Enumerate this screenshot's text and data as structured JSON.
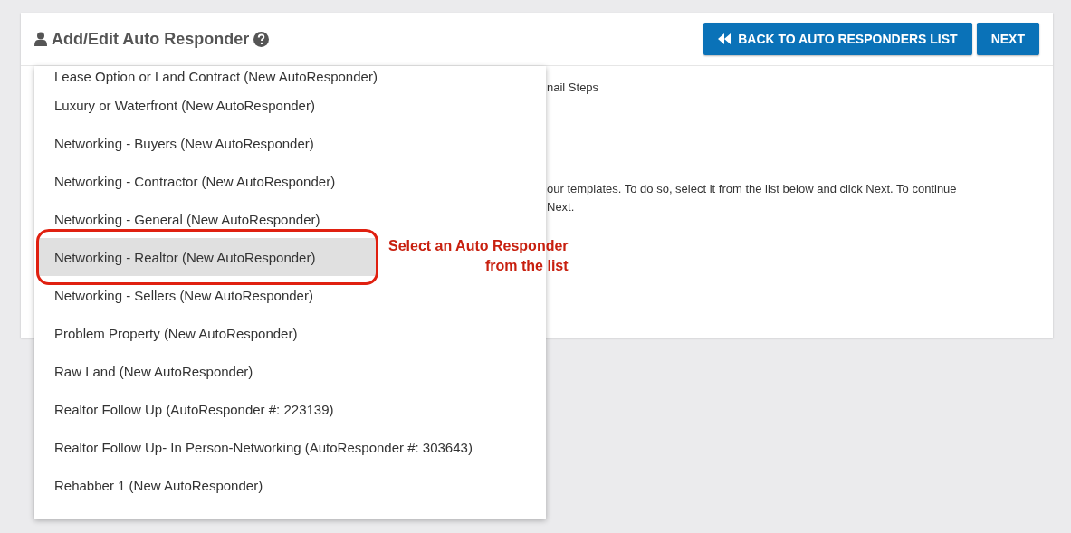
{
  "header": {
    "title": "Add/Edit Auto Responder",
    "buttons": [
      {
        "label": "BACK TO AUTO RESPONDERS LIST",
        "kind": "back"
      },
      {
        "label": "NEXT",
        "kind": "plain"
      }
    ]
  },
  "background": {
    "tab_label": "nail Steps",
    "paragraph_lines": [
      "our templates. To do so, select it from the list below and click Next. To continue",
      "Next."
    ]
  },
  "dropdown": {
    "items": [
      {
        "label": "Lease Option or Land Contract (New AutoResponder)",
        "selected": false
      },
      {
        "label": "Luxury or Waterfront (New AutoResponder)",
        "selected": false
      },
      {
        "label": "Networking - Buyers (New AutoResponder)",
        "selected": false
      },
      {
        "label": "Networking - Contractor (New AutoResponder)",
        "selected": false
      },
      {
        "label": "Networking - General (New AutoResponder)",
        "selected": false
      },
      {
        "label": "Networking - Realtor (New AutoResponder)",
        "selected": true
      },
      {
        "label": "Networking - Sellers (New AutoResponder)",
        "selected": false
      },
      {
        "label": "Problem Property (New AutoResponder)",
        "selected": false
      },
      {
        "label": "Raw Land (New AutoResponder)",
        "selected": false
      },
      {
        "label": "Realtor Follow Up (AutoResponder #: 223139)",
        "selected": false
      },
      {
        "label": "Realtor Follow Up- In Person-Networking (AutoResponder #: 303643)",
        "selected": false
      },
      {
        "label": "Rehabber 1 (New AutoResponder)",
        "selected": false
      }
    ]
  },
  "annotation": {
    "text_lines": [
      "Select an Auto Responder",
      "from the list"
    ]
  }
}
